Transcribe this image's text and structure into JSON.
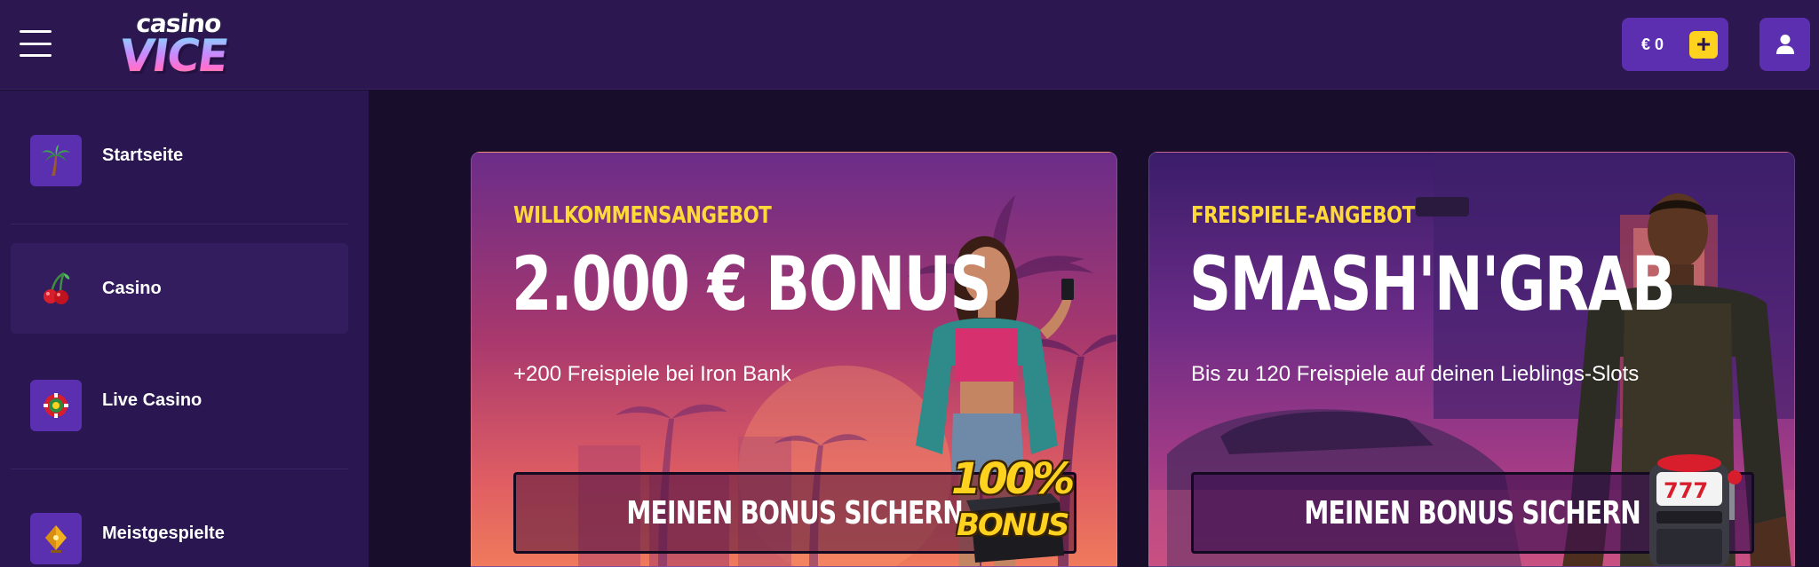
{
  "header": {
    "menu_icon": "hamburger-menu-icon",
    "logo": {
      "top": "casino",
      "main": "VICE"
    },
    "balance": {
      "amount": "€ 0",
      "add_label": "+"
    },
    "user_icon": "user-icon"
  },
  "sidebar": {
    "items": [
      {
        "label": "Startseite",
        "icon": "palm-tree-icon",
        "active": false
      },
      {
        "label": "Casino",
        "icon": "cherries-icon",
        "active": true
      },
      {
        "label": "Live Casino",
        "icon": "casino-chip-icon",
        "active": false
      },
      {
        "label": "Meistgespielte",
        "icon": "trophy-icon",
        "active": false
      }
    ]
  },
  "promos": [
    {
      "kicker": "WILLKOMMENSANGEBOT",
      "headline": "2.000 € BONUS",
      "subtitle": "+200 Freispiele bei Iron Bank",
      "cta": "MEINEN BONUS SICHERN",
      "badge_top": "100%",
      "badge_bottom": "BONUS"
    },
    {
      "kicker": "FREISPIELE-ANGEBOT",
      "headline": "SMASH'N'GRAB",
      "subtitle": "Bis zu 120 Freispiele auf deinen Lieblings-Slots",
      "cta": "MEINEN BONUS SICHERN",
      "badge_icon": "slot-machine-icon"
    }
  ],
  "colors": {
    "header_bg": "#2c1750",
    "sidebar_bg": "#2a1650",
    "page_bg": "#190d2c",
    "accent_purple": "#5b2fb0",
    "accent_yellow": "#ffd21f"
  }
}
